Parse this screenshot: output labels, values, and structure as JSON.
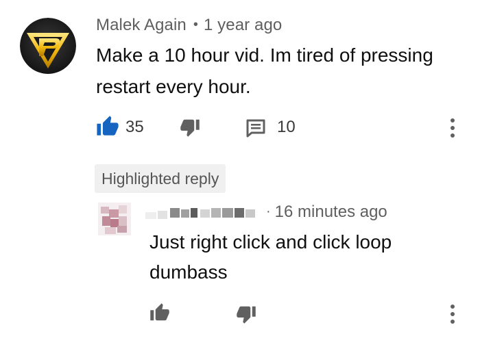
{
  "comment": {
    "author": "Malek Again",
    "separator": "•",
    "timestamp": "1 year ago",
    "text": "Make a 10 hour vid. Im tired of pressing restart every hour.",
    "likes": "35",
    "replies": "10",
    "like_state": "liked",
    "accent_color": "#1565c0"
  },
  "highlighted_reply": {
    "chip_label": "Highlighted reply",
    "separator": "·",
    "timestamp": "16 minutes ago",
    "text": "Just right click and click loop dumbass",
    "author_redacted": true
  },
  "icons": {
    "like": "thumbs-up-icon",
    "dislike": "thumbs-down-icon",
    "reply": "reply-comment-icon",
    "more": "more-vertical-icon"
  }
}
